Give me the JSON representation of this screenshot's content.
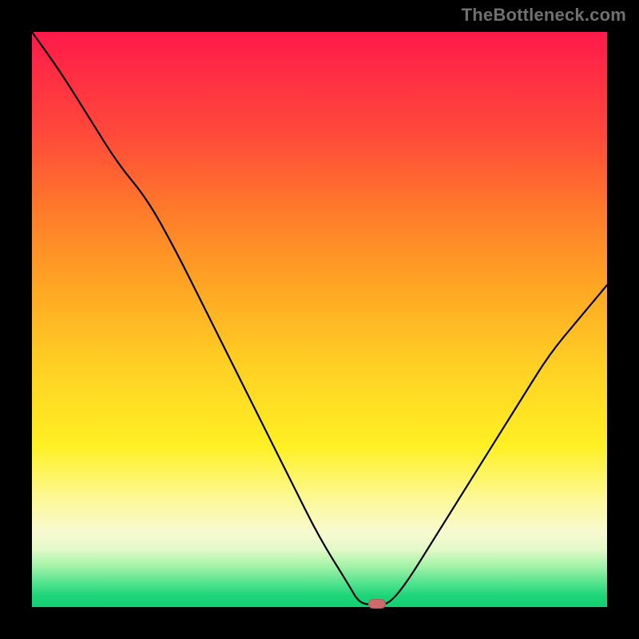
{
  "watermark": "TheBottleneck.com",
  "colors": {
    "page_bg": "#000000",
    "watermark_text": "#707070",
    "curve_stroke": "#000000",
    "marker_fill": "#d06a6a",
    "gradient_top": "#ff1a4a",
    "gradient_bottom": "#12d072"
  },
  "chart_data": {
    "type": "line",
    "title": "",
    "xlabel": "",
    "ylabel": "",
    "xlim": [
      0,
      100
    ],
    "ylim": [
      0,
      100
    ],
    "note": "y is visual height from bottom, 0 = bottom (green / optimal), 100 = top (red / worst bottleneck). x is horizontal position 0–100.",
    "x": [
      0,
      5,
      10,
      15,
      20,
      25,
      30,
      35,
      40,
      45,
      50,
      55,
      57,
      60,
      62,
      65,
      70,
      75,
      80,
      85,
      90,
      95,
      100
    ],
    "y": [
      100,
      93,
      85,
      77,
      71,
      62,
      52,
      42,
      32,
      22,
      12,
      4,
      0.5,
      0.5,
      0.5,
      4,
      12,
      20,
      28,
      36,
      44,
      50,
      56
    ],
    "marker": {
      "x": 60,
      "y": 0.5,
      "label": "optimal-point"
    },
    "grid": false,
    "legend": false
  }
}
